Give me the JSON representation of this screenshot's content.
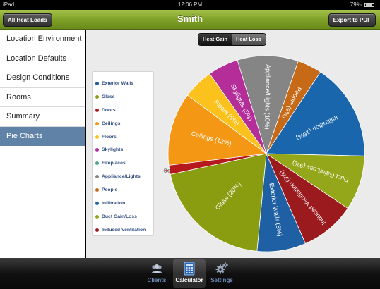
{
  "status_bar": {
    "device": "iPad",
    "time": "12:06 PM",
    "battery": "79%"
  },
  "header": {
    "title": "Smith",
    "left_button": "All Heat Loads",
    "right_button": "Export to PDF",
    "color": "#7d9f26"
  },
  "sidebar": {
    "items": [
      {
        "label": "Location Environment"
      },
      {
        "label": "Location Defaults"
      },
      {
        "label": "Design Conditions"
      },
      {
        "label": "Rooms"
      },
      {
        "label": "Summary"
      },
      {
        "label": "Pie Charts",
        "active": true
      }
    ]
  },
  "segmented": {
    "options": [
      "Heat Gain",
      "Heat Loss"
    ],
    "selected": "Heat Gain"
  },
  "chart_data": {
    "type": "pie",
    "title": "",
    "legend_placement": "left",
    "series": [
      {
        "name": "Exterior Walls",
        "label": "Exterior Walls (8%)",
        "value": 8,
        "color": "#1f5fa3",
        "show": true
      },
      {
        "name": "Glass",
        "label": "Glass (20%)",
        "value": 20,
        "color": "#8a9c10",
        "show": true
      },
      {
        "name": "Doors",
        "label": "Do",
        "value": 1.5,
        "color": "#b5191e",
        "show": true
      },
      {
        "name": "Ceilings",
        "label": "Ceilings (12%)",
        "value": 12,
        "color": "#f39714",
        "show": true
      },
      {
        "name": "Floors",
        "label": "Floors (5%)",
        "value": 5,
        "color": "#fbc21d",
        "show": true
      },
      {
        "name": "Skylights",
        "label": "Skylights (5%)",
        "value": 5,
        "color": "#b42d99",
        "show": true
      },
      {
        "name": "Fireplaces",
        "label": "",
        "value": 0,
        "color": "#46a78b",
        "show": false
      },
      {
        "name": "Appliance/Lights",
        "label": "Appliance/Lights (10%)",
        "value": 10,
        "color": "#858585",
        "show": true
      },
      {
        "name": "People",
        "label": "People (4%)",
        "value": 4,
        "color": "#c76a18",
        "show": true
      },
      {
        "name": "Infiltration",
        "label": "Infiltration (16%)",
        "value": 16,
        "color": "#1966ad",
        "show": true
      },
      {
        "name": "Duct Gain/Loss",
        "label": "Duct Gain/Loss (9%)",
        "value": 9,
        "color": "#94a619",
        "show": true
      },
      {
        "name": "Induced Ventilation",
        "label": "Induced Ventilation (9%)",
        "value": 9,
        "color": "#9b1a1e",
        "show": true
      }
    ]
  },
  "tab_bar": {
    "tabs": [
      {
        "label": "Clients",
        "icon": "people-icon"
      },
      {
        "label": "Calculator",
        "icon": "calculator-icon",
        "active": true
      },
      {
        "label": "Settings",
        "icon": "gears-icon"
      }
    ]
  }
}
